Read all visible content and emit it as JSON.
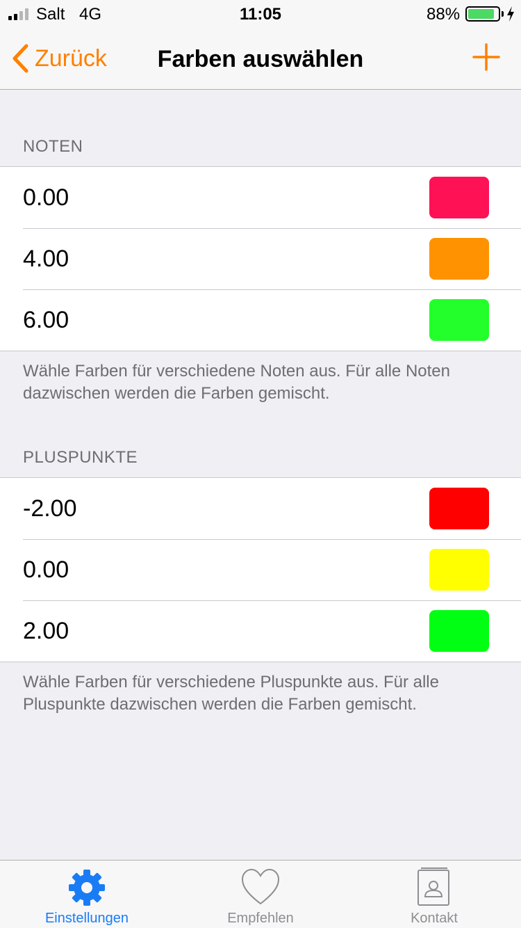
{
  "status_bar": {
    "carrier": "Salt",
    "network": "4G",
    "time": "11:05",
    "battery_percent": "88%",
    "battery_level": 0.88
  },
  "nav": {
    "back_label": "Zurück",
    "title": "Farben auswählen",
    "accent_color": "#ff8000"
  },
  "sections": [
    {
      "header": "NOTEN",
      "rows": [
        {
          "value": "0.00",
          "color": "#ff1156"
        },
        {
          "value": "4.00",
          "color": "#ff9200"
        },
        {
          "value": "6.00",
          "color": "#22ff2a"
        }
      ],
      "footer": "Wähle Farben für verschiedene Noten aus. Für alle Noten dazwischen werden die Farben gemischt."
    },
    {
      "header": "PLUSPUNKTE",
      "rows": [
        {
          "value": "-2.00",
          "color": "#ff0000"
        },
        {
          "value": "0.00",
          "color": "#ffff00"
        },
        {
          "value": "2.00",
          "color": "#00ff12"
        }
      ],
      "footer": "Wähle Farben für verschiedene Pluspunkte aus. Für alle Pluspunkte dazwischen werden die Farben gemischt."
    }
  ],
  "tab_bar": {
    "tabs": [
      {
        "label": "Einstellungen",
        "icon": "gear-icon",
        "active": true
      },
      {
        "label": "Empfehlen",
        "icon": "heart-icon",
        "active": false
      },
      {
        "label": "Kontakt",
        "icon": "contact-card-icon",
        "active": false
      }
    ],
    "active_color": "#1a7cf5",
    "inactive_color": "#8e8e93"
  }
}
